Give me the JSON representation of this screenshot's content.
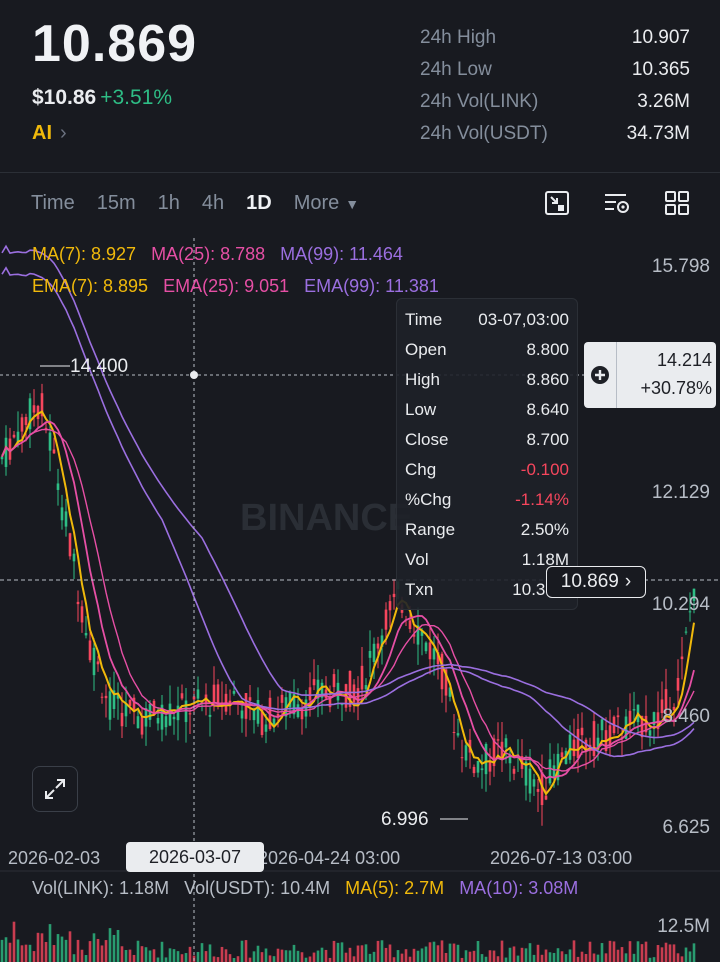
{
  "header": {
    "last_price": "10.869",
    "usd_price": "$10.86",
    "change_pct": "+3.51%",
    "ai_label": "AI",
    "stats": [
      {
        "label": "24h High",
        "value": "10.907"
      },
      {
        "label": "24h Low",
        "value": "10.365"
      },
      {
        "label": "24h Vol(LINK)",
        "value": "3.26M"
      },
      {
        "label": "24h Vol(USDT)",
        "value": "34.73M"
      }
    ]
  },
  "intervals": {
    "time": "Time",
    "m15": "15m",
    "h1": "1h",
    "h4": "4h",
    "d1": "1D",
    "more": "More",
    "active": "1D"
  },
  "indicators": {
    "ma7": "MA(7): 8.927",
    "ma25": "MA(25): 8.788",
    "ma99": "MA(99): 11.464",
    "ema7": "EMA(7): 8.895",
    "ema25": "EMA(25): 9.051",
    "ema99": "EMA(99): 11.381"
  },
  "axis": {
    "y_labels": [
      "15.798",
      "12.129",
      "10.294",
      "8.460",
      "6.625"
    ],
    "x_labels": [
      "2026-02-03",
      "2026-04-24 03:00",
      "2026-07-13 03:00"
    ],
    "selected_date": "2026-03-07",
    "high_marker": "14.400",
    "low_marker": "6.996"
  },
  "tooltip": {
    "rows": [
      {
        "label": "Time",
        "value": "03-07,03:00"
      },
      {
        "label": "Open",
        "value": "8.800"
      },
      {
        "label": "High",
        "value": "8.860"
      },
      {
        "label": "Low",
        "value": "8.640"
      },
      {
        "label": "Close",
        "value": "8.700"
      },
      {
        "label": "Chg",
        "value": "-0.100"
      },
      {
        "label": "%Chg",
        "value": "-1.14%"
      },
      {
        "label": "Range",
        "value": "2.50%"
      },
      {
        "label": "Vol",
        "value": "1.18M"
      },
      {
        "label": "Txn",
        "value": "10.37M"
      }
    ]
  },
  "crosshair": {
    "price": "14.214",
    "pct": "+30.78%"
  },
  "now_price_tag": "10.869",
  "volume": {
    "vol_link": "Vol(LINK): 1.18M",
    "vol_usdt": "Vol(USDT): 10.4M",
    "ma5": "MA(5): 2.7M",
    "ma10": "MA(10): 3.08M",
    "axis_top": "12.5M"
  },
  "watermark": "BINANCE",
  "colors": {
    "up": "#2ebd85",
    "down": "#f6465d",
    "ma7": "#f0b90b",
    "ma25": "#e64fa5",
    "ma99": "#9b6fe0"
  }
}
